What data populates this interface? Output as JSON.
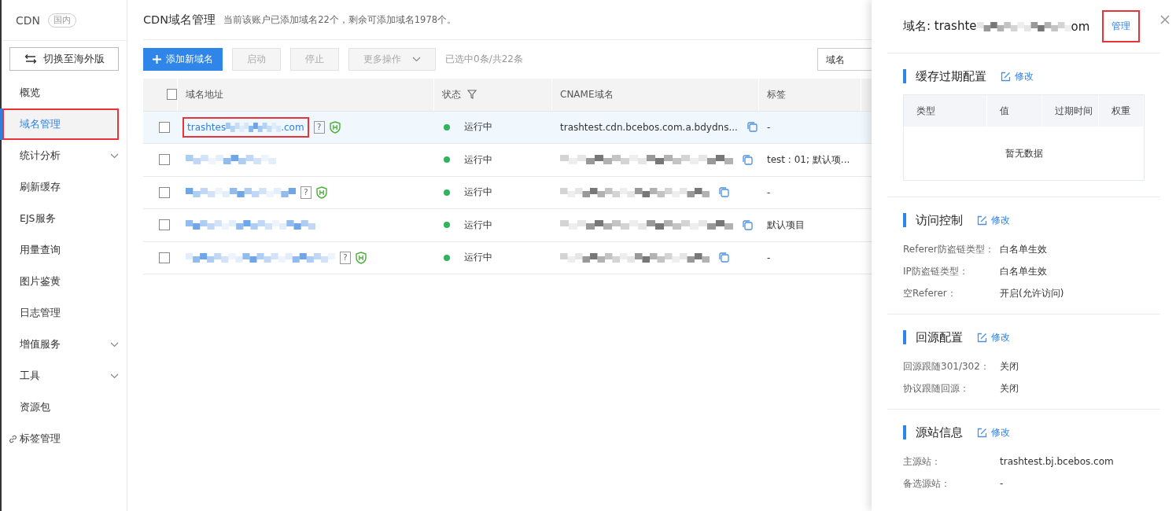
{
  "sidebar": {
    "product": "CDN",
    "region_badge": "国内",
    "switch_button": "切换至海外版",
    "items": [
      {
        "label": "概览",
        "selected": false,
        "highlighted": false,
        "kind": "plain"
      },
      {
        "label": "域名管理",
        "selected": true,
        "highlighted": true,
        "kind": "plain"
      },
      {
        "label": "统计分析",
        "selected": false,
        "highlighted": false,
        "kind": "expandable"
      },
      {
        "label": "刷新缓存",
        "selected": false,
        "highlighted": false,
        "kind": "plain"
      },
      {
        "label": "EJS服务",
        "selected": false,
        "highlighted": false,
        "kind": "plain"
      },
      {
        "label": "用量查询",
        "selected": false,
        "highlighted": false,
        "kind": "plain"
      },
      {
        "label": "图片鉴黄",
        "selected": false,
        "highlighted": false,
        "kind": "plain"
      },
      {
        "label": "日志管理",
        "selected": false,
        "highlighted": false,
        "kind": "plain"
      },
      {
        "label": "增值服务",
        "selected": false,
        "highlighted": false,
        "kind": "expandable"
      },
      {
        "label": "工具",
        "selected": false,
        "highlighted": false,
        "kind": "expandable"
      },
      {
        "label": "资源包",
        "selected": false,
        "highlighted": false,
        "kind": "plain"
      },
      {
        "label": "标签管理",
        "selected": false,
        "highlighted": false,
        "kind": "tag"
      }
    ]
  },
  "header": {
    "title": "CDN域名管理",
    "subtitle": "当前该账户已添加域名22个，剩余可添加域名1978个。"
  },
  "toolbar": {
    "add_button": "添加新域名",
    "buttons": [
      {
        "label": "启动",
        "disabled": true
      },
      {
        "label": "停止",
        "disabled": true
      },
      {
        "label": "更多操作",
        "disabled": true
      }
    ],
    "selection_info": "已选中0条/共22条",
    "search_type": "域名"
  },
  "table": {
    "all_selected": false,
    "columns": [
      "域名地址",
      "状态",
      "CNAME域名",
      "标签"
    ],
    "rows": [
      {
        "selected": false,
        "hovered": true,
        "domain_prefix": "trashtes",
        "domain_suffix": ".com",
        "highlighted": true,
        "help": "?",
        "status": "运行中",
        "cname": "trashtest.cdn.bcebos.com.a.bdydns...",
        "tag": "-"
      },
      {
        "selected": false,
        "hovered": false,
        "status": "运行中",
        "tag": "test : 01; 默认项..."
      },
      {
        "selected": false,
        "hovered": false,
        "help": "?",
        "status": "运行中",
        "tag": "-"
      },
      {
        "selected": false,
        "hovered": false,
        "status": "运行中",
        "tag": "默认项目"
      },
      {
        "selected": false,
        "hovered": false,
        "help": "?",
        "status": "运行中",
        "tag": "-"
      }
    ]
  },
  "drawer": {
    "title_prefix": "域名: trashte",
    "title_suffix": "om",
    "manage_link": "管理",
    "manage_highlighted": true,
    "sections": [
      {
        "kind": "table",
        "title": "缓存过期配置",
        "edit": "修改",
        "columns": [
          "类型",
          "值",
          "过期时间",
          "权重"
        ],
        "empty": "暂无数据"
      },
      {
        "kind": "fields",
        "title": "访问控制",
        "edit": "修改",
        "fields": [
          {
            "label": "Referer防盗链类型：",
            "value": "白名单生效"
          },
          {
            "label": "IP防盗链类型：",
            "value": "白名单生效"
          },
          {
            "label": "空Referer：",
            "value": "开启(允许访问)"
          }
        ]
      },
      {
        "kind": "fields",
        "title": "回源配置",
        "edit": "修改",
        "fields": [
          {
            "label": "回源跟随301/302：",
            "value": "关闭"
          },
          {
            "label": "协议跟随回源：",
            "value": "关闭"
          }
        ]
      },
      {
        "kind": "fields",
        "title": "源站信息",
        "edit": "修改",
        "fields": [
          {
            "label": "主源站：",
            "value": "trashtest.bj.bcebos.com"
          },
          {
            "label": "备选源站：",
            "value": "-"
          }
        ]
      }
    ]
  }
}
